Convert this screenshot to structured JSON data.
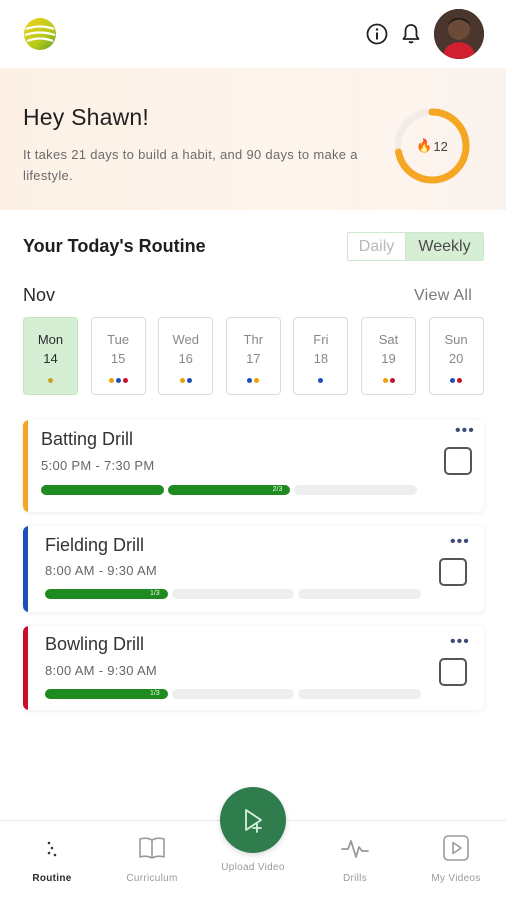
{
  "greeting": {
    "title": "Hey Shawn!",
    "subtitle": "It takes 21 days to build a habit, and 90 days to make a lifestyle.",
    "streak_count": "12",
    "streak_progress": 0.72
  },
  "routine": {
    "title": "Your Today's Routine",
    "toggle": {
      "daily": "Daily",
      "weekly": "Weekly",
      "selected": "Weekly"
    },
    "month": "Nov",
    "view_all": "View All"
  },
  "days": [
    {
      "name": "Mon",
      "num": "14",
      "active": true,
      "dots": [
        "#c9a227"
      ]
    },
    {
      "name": "Tue",
      "num": "15",
      "active": false,
      "dots": [
        "#f0a000",
        "#1e4fb8",
        "#c8102e"
      ]
    },
    {
      "name": "Wed",
      "num": "16",
      "active": false,
      "dots": [
        "#f0a000",
        "#1e4fb8"
      ]
    },
    {
      "name": "Thr",
      "num": "17",
      "active": false,
      "dots": [
        "#1e4fb8",
        "#f0a000"
      ]
    },
    {
      "name": "Fri",
      "num": "18",
      "active": false,
      "dots": [
        "#1e4fb8"
      ]
    },
    {
      "name": "Sat",
      "num": "19",
      "active": false,
      "dots": [
        "#f0a000",
        "#c8102e"
      ]
    },
    {
      "name": "Sun",
      "num": "20",
      "active": false,
      "dots": [
        "#1e4fb8",
        "#c8102e"
      ]
    }
  ],
  "drills": [
    {
      "title": "Batting Drill",
      "time": "5:00 PM - 7:30 PM",
      "color": "#f5a623",
      "progress_label": "2/3",
      "completed": 2,
      "total": 3
    },
    {
      "title": "Fielding Drill",
      "time": "8:00 AM - 9:30 AM",
      "color": "#1e4fb8",
      "progress_label": "1/3",
      "completed": 1,
      "total": 3
    },
    {
      "title": "Bowling Drill",
      "time": "8:00 AM - 9:30 AM",
      "color": "#c8102e",
      "progress_label": "1/3",
      "completed": 1,
      "total": 3
    }
  ],
  "nav": {
    "routine": "Routine",
    "curriculum": "Curriculum",
    "upload": "Upload Video",
    "drills": "Drills",
    "my_videos": "My Videos"
  },
  "colors": {
    "accent_green": "#2f7d4c",
    "progress_green": "#1f8a1f",
    "streak_orange": "#f5a623"
  },
  "icons": {
    "logo": "logo-icon",
    "info": "info-icon",
    "bell": "bell-icon",
    "more": "more-icon",
    "upload": "upload-video-icon"
  }
}
